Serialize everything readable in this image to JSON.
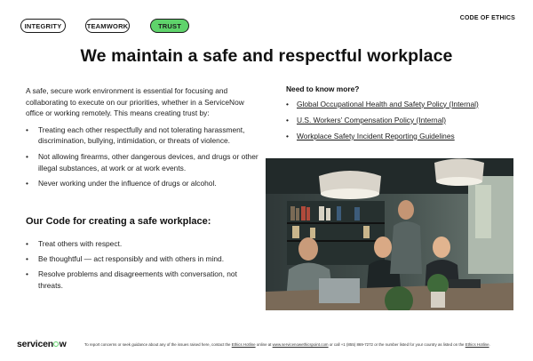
{
  "tabs": [
    {
      "label": "INTEGRITY",
      "active": false
    },
    {
      "label": "TEAMWORK",
      "active": false
    },
    {
      "label": "TRUST",
      "active": true
    }
  ],
  "corner_title": "CODE OF ETHICS",
  "headline": "We maintain a safe and respectful workplace",
  "intro": "A safe, secure work environment is essential for focusing and collaborating to execute on our priorities, whether in a ServiceNow office or working remotely. This means creating trust by:",
  "trust_items": [
    "Treating each other respectfully and not tolerating harassment, discrimination, bullying, intimidation, or threats of violence.",
    "Not allowing firearms, other dangerous devices, and drugs or other illegal substances, at work or at work events.",
    "Never working under the influence of drugs or alcohol."
  ],
  "code_heading": "Our Code for creating a safe workplace:",
  "code_items": [
    "Treat others with respect.",
    "Be thoughtful — act responsibly and with others in mind.",
    "Resolve problems and disagreements with conversation, not threats."
  ],
  "need_heading": "Need to know more?",
  "links": [
    "Global Occupational Health and Safety Policy (Internal)",
    "U.S. Workers’ Compensation Policy (Internal)",
    "Workplace Safety Incident Reporting Guidelines"
  ],
  "footer": {
    "logo_pre": "servicen",
    "logo_post": "w",
    "note_1": "To report concerns or seek guidance about any of the issues raised here, contact the ",
    "hotline_link": "Ethics Hotline",
    "note_2": " online at ",
    "site_link": "www.servicenowethicspoint.com",
    "note_3": " or call +1 (855) 869-7272 or the number listed for your country as listed on the ",
    "hotline_link_2": "Ethics Hotline",
    "note_4": "."
  },
  "colors": {
    "accent_green": "#5fd36b",
    "text": "#1a1a1a"
  }
}
